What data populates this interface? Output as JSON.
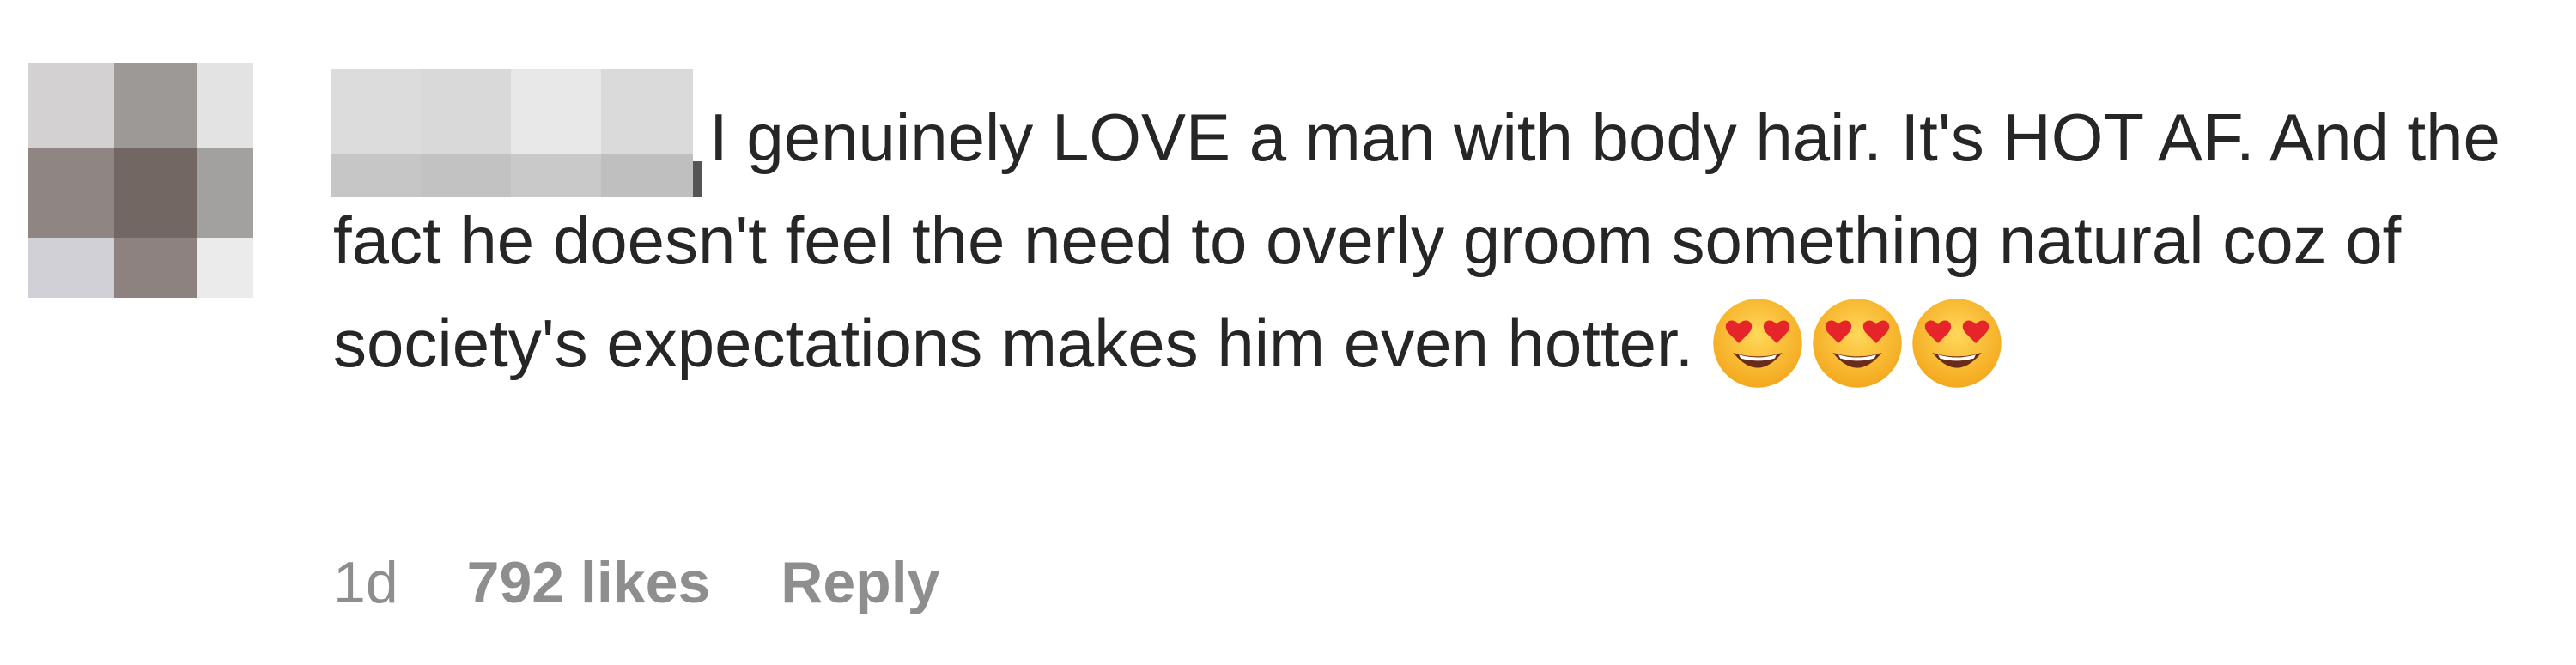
{
  "comment": {
    "text": "I genuinely LOVE a man with body hair. It's HOT AF. And the fact he doesn't feel the need to overly groom something natural coz of society's expectations makes him even hotter.",
    "emoji_icons": [
      "heart-eyes-emoji",
      "heart-eyes-emoji",
      "heart-eyes-emoji"
    ],
    "time_ago": "1d",
    "likes_label": "792 likes",
    "reply_label": "Reply"
  },
  "colors": {
    "text": "#262626",
    "meta_text": "#8e8e8e",
    "background": "#ffffff"
  }
}
